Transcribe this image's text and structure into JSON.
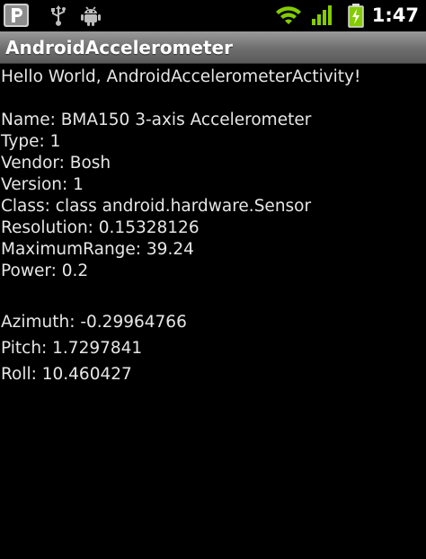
{
  "status_bar": {
    "icons": [
      "p-app-icon",
      "usb-icon",
      "android-debug-icon"
    ],
    "right_icons": [
      "wifi-icon",
      "signal-icon",
      "battery-icon"
    ],
    "time": "1:47",
    "wifi_color": "#84cc00",
    "signal_color": "#84cc00",
    "battery_color": "#84cc00"
  },
  "title_bar": {
    "title": "AndroidAccelerometer"
  },
  "content": {
    "greeting": "Hello World, AndroidAccelerometerActivity!",
    "sensor": {
      "name": "Name: BMA150 3-axis Accelerometer",
      "type": "Type: 1",
      "vendor": "Vendor: Bosh",
      "version": "Version: 1",
      "class": "Class: class android.hardware.Sensor",
      "resolution": "Resolution: 0.15328126",
      "maximum_range": "MaximumRange: 39.24",
      "power": "Power: 0.2"
    },
    "orientation": {
      "azimuth": "Azimuth: -0.29964766",
      "pitch": "Pitch: 1.7297841",
      "roll": "Roll: 10.460427"
    }
  }
}
